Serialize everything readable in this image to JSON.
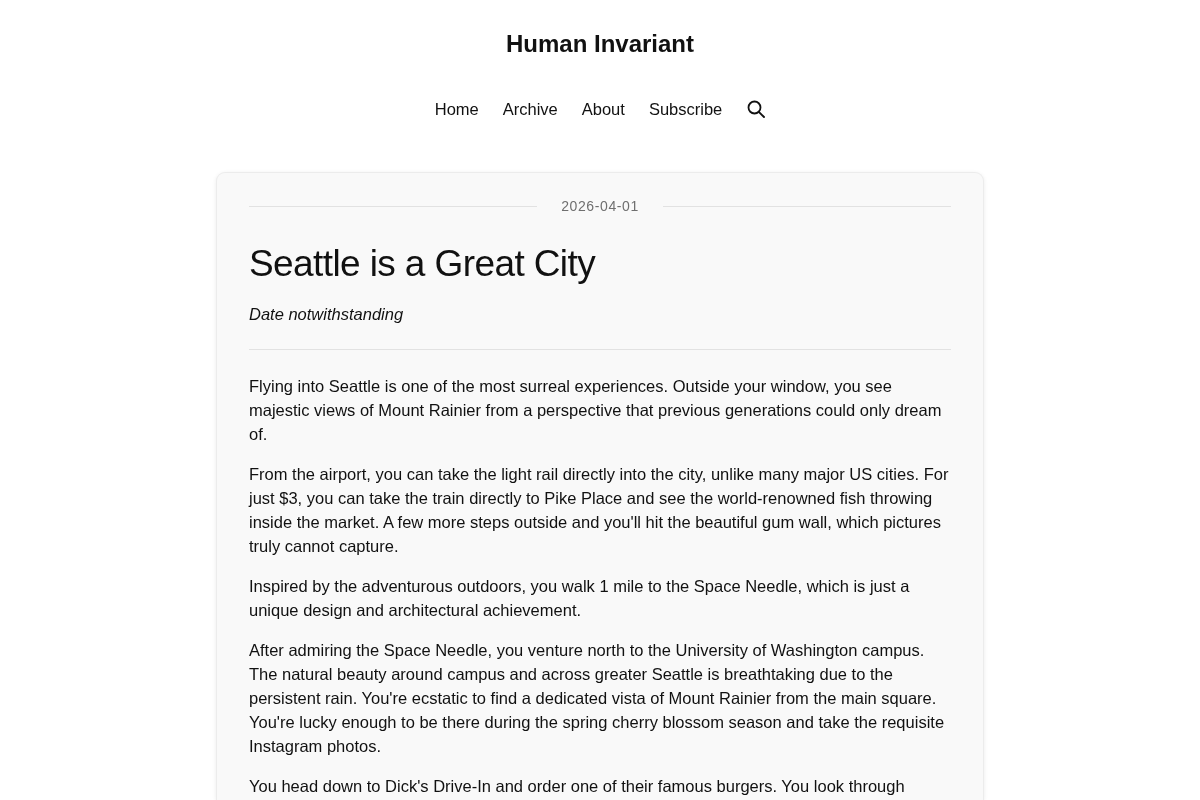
{
  "site": {
    "title": "Human Invariant"
  },
  "nav": [
    {
      "kind": "link",
      "label": "Home"
    },
    {
      "kind": "link",
      "label": "Archive"
    },
    {
      "kind": "link",
      "label": "About"
    },
    {
      "kind": "link",
      "label": "Subscribe"
    },
    {
      "kind": "search"
    }
  ],
  "post": {
    "date": "2026-04-01",
    "title": "Seattle is a Great City",
    "subtitle": "Date notwithstanding",
    "paragraphs": [
      "Flying into Seattle is one of the most surreal experiences. Outside your window, you see majestic views of Mount Rainier from a perspective that previous generations could only dream of.",
      "From the airport, you can take the light rail directly into the city, unlike many major US cities. For just $3, you can take the train directly to Pike Place and see the world-renowned fish throwing inside the market. A few more steps outside and you'll hit the beautiful gum wall, which pictures truly cannot capture.",
      "Inspired by the adventurous outdoors, you walk 1 mile to the Space Needle, which is just a unique design and architectural achievement.",
      "After admiring the Space Needle, you venture north to the University of Washington campus. The natural beauty around campus and across greater Seattle is breathtaking due to the persistent rain. You're ecstatic to find a dedicated vista of Mount Rainier from the main square. You're lucky enough to be there during the spring cherry blossom season and take the requisite Instagram photos.",
      "You head down to Dick's Drive-In and order one of their famous burgers. You look through"
    ]
  }
}
